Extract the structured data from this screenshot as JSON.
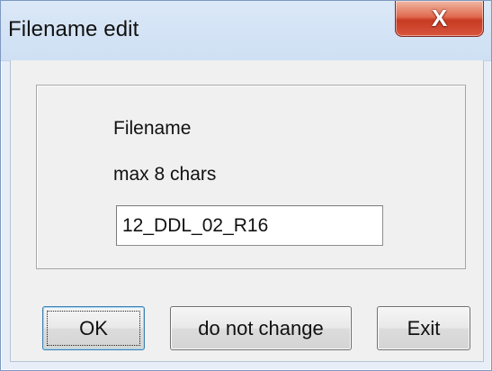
{
  "window": {
    "title": "Filename edit",
    "close_symbol": "X"
  },
  "form": {
    "label": "Filename",
    "hint": "max 8 chars",
    "value": "12_DDL_02_R16"
  },
  "buttons": {
    "ok": "OK",
    "keep": "do not change",
    "exit": "Exit"
  },
  "colors": {
    "close_button": "#d8553e",
    "titlebar": "#d3e3f5",
    "dialog_background": "#f0f0f0",
    "default_button_border": "#3c7fb1"
  },
  "icons": {
    "close": "close-icon"
  }
}
